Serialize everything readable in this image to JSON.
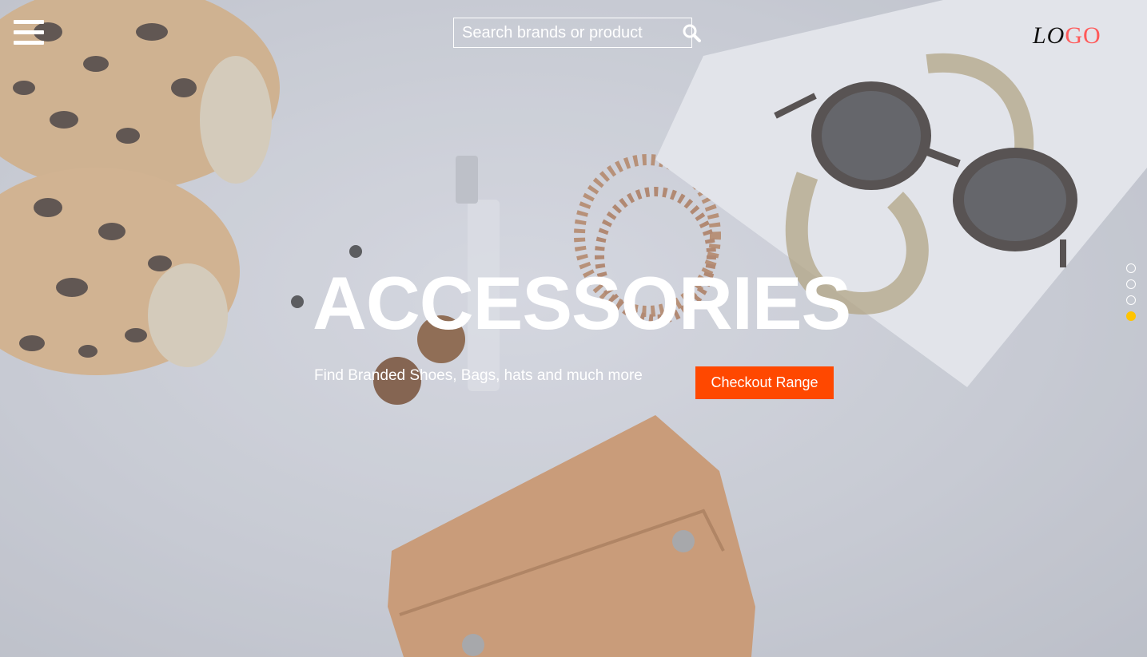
{
  "search": {
    "placeholder": "Search brands or product",
    "icon": "search-icon"
  },
  "logo": {
    "part1": "LO",
    "part2": "GO"
  },
  "hero": {
    "title": "ACCESSORIES",
    "subtitle": "Find Branded Shoes, Bags, hats and much more",
    "cta_label": "Checkout Range"
  },
  "slider": {
    "total": 4,
    "active_index": 4
  },
  "colors": {
    "accent": "#ff4800",
    "active_dot": "#ffc400",
    "logo_highlight": "#ff5a5a"
  }
}
